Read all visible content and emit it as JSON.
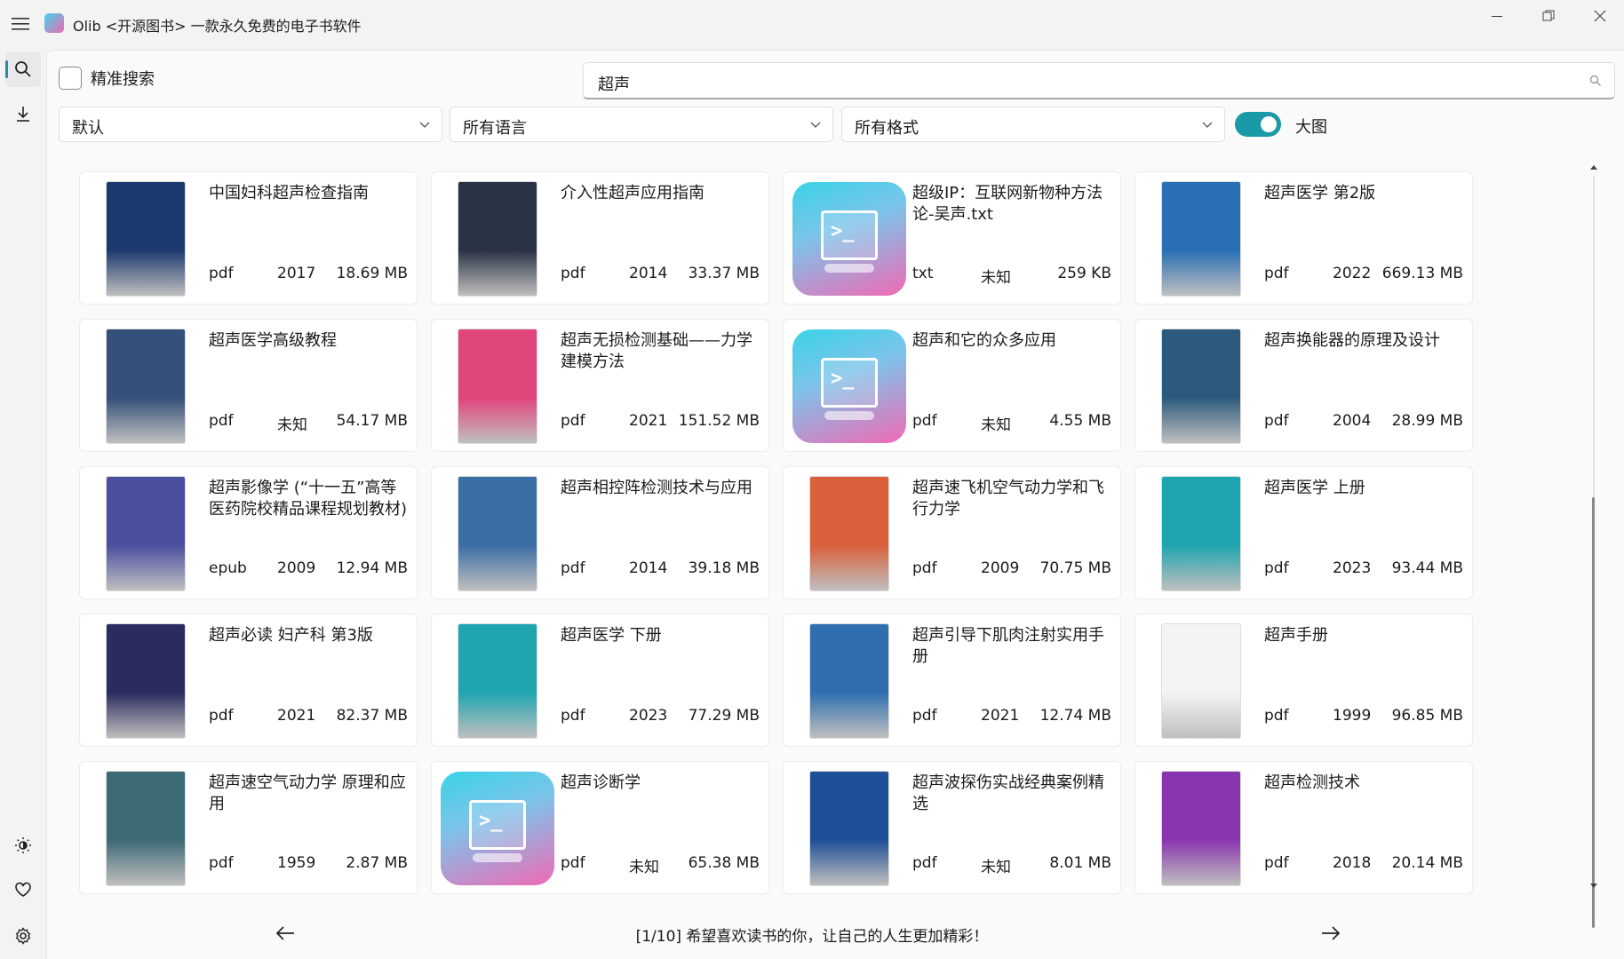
{
  "window": {
    "title": "Olib <开源图书> 一款永久免费的电子书软件"
  },
  "nav": {
    "items": [
      {
        "icon": "search-icon"
      },
      {
        "icon": "download-icon"
      },
      {
        "icon": "brightness-icon"
      },
      {
        "icon": "heart-icon"
      },
      {
        "icon": "gear-icon"
      }
    ]
  },
  "filters": {
    "exact_search_label": "精准搜索",
    "exact_search_checked": false,
    "search_value": "超声",
    "sort": "默认",
    "language": "所有语言",
    "format": "所有格式",
    "large_view_label": "大图",
    "large_view_on": true
  },
  "books": [
    {
      "title": "中国妇科超声检查指南",
      "format": "pdf",
      "year": "2017",
      "size": "18.69 MB",
      "cover": "img",
      "cover_color": "#1d3a6e"
    },
    {
      "title": "介入性超声应用指南",
      "format": "pdf",
      "year": "2014",
      "size": "33.37 MB",
      "cover": "img",
      "cover_color": "#2a3346"
    },
    {
      "title": "超级IP：互联网新物种方法论-吴声.txt",
      "format": "txt",
      "year": "未知",
      "size": "259 KB",
      "cover": "default"
    },
    {
      "title": "超声医学 第2版",
      "format": "pdf",
      "year": "2022",
      "size": "669.13 MB",
      "cover": "img",
      "cover_color": "#2a6fb5"
    },
    {
      "title": "超声医学高级教程",
      "format": "pdf",
      "year": "未知",
      "size": "54.17 MB",
      "cover": "img",
      "cover_color": "#35507a"
    },
    {
      "title": "超声无损检测基础——力学建模方法",
      "format": "pdf",
      "year": "2021",
      "size": "151.52 MB",
      "cover": "img",
      "cover_color": "#e0457c"
    },
    {
      "title": "超声和它的众多应用",
      "format": "pdf",
      "year": "未知",
      "size": "4.55 MB",
      "cover": "default"
    },
    {
      "title": "超声换能器的原理及设计",
      "format": "pdf",
      "year": "2004",
      "size": "28.99 MB",
      "cover": "img",
      "cover_color": "#2c5a7c"
    },
    {
      "title": "超声影像学 (“十一五”高等医药院校精品课程规划教材)",
      "format": "epub",
      "year": "2009",
      "size": "12.94 MB",
      "cover": "img",
      "cover_color": "#4a4fa0"
    },
    {
      "title": "超声相控阵检测技术与应用",
      "format": "pdf",
      "year": "2014",
      "size": "39.18 MB",
      "cover": "img",
      "cover_color": "#3b6ea5"
    },
    {
      "title": "超声速飞机空气动力学和飞行力学",
      "format": "pdf",
      "year": "2009",
      "size": "70.75 MB",
      "cover": "img",
      "cover_color": "#d9603a"
    },
    {
      "title": "超声医学 上册",
      "format": "pdf",
      "year": "2023",
      "size": "93.44 MB",
      "cover": "img",
      "cover_color": "#1fa5b0"
    },
    {
      "title": "超声必读 妇产科 第3版",
      "format": "pdf",
      "year": "2021",
      "size": "82.37 MB",
      "cover": "img",
      "cover_color": "#2b2b5e"
    },
    {
      "title": "超声医学 下册",
      "format": "pdf",
      "year": "2023",
      "size": "77.29 MB",
      "cover": "img",
      "cover_color": "#1fa5b0"
    },
    {
      "title": "超声引导下肌肉注射实用手册",
      "format": "pdf",
      "year": "2021",
      "size": "12.74 MB",
      "cover": "img",
      "cover_color": "#2f6fb0"
    },
    {
      "title": "超声手册",
      "format": "pdf",
      "year": "1999",
      "size": "96.85 MB",
      "cover": "img",
      "cover_color": "#f4f4f4"
    },
    {
      "title": "超声速空气动力学 原理和应用",
      "format": "pdf",
      "year": "1959",
      "size": "2.87 MB",
      "cover": "img",
      "cover_color": "#3c6a75"
    },
    {
      "title": "超声诊断学",
      "format": "pdf",
      "year": "未知",
      "size": "65.38 MB",
      "cover": "default"
    },
    {
      "title": "超声波探伤实战经典案例精选",
      "format": "pdf",
      "year": "未知",
      "size": "8.01 MB",
      "cover": "img",
      "cover_color": "#1f4f96"
    },
    {
      "title": "超声检测技术",
      "format": "pdf",
      "year": "2018",
      "size": "20.14 MB",
      "cover": "img",
      "cover_color": "#8a35b0"
    }
  ],
  "pager": {
    "text": "[1/10] 希望喜欢读书的你，让自己的人生更加精彩！"
  },
  "colors": {
    "accent": "#1a9aa6"
  }
}
